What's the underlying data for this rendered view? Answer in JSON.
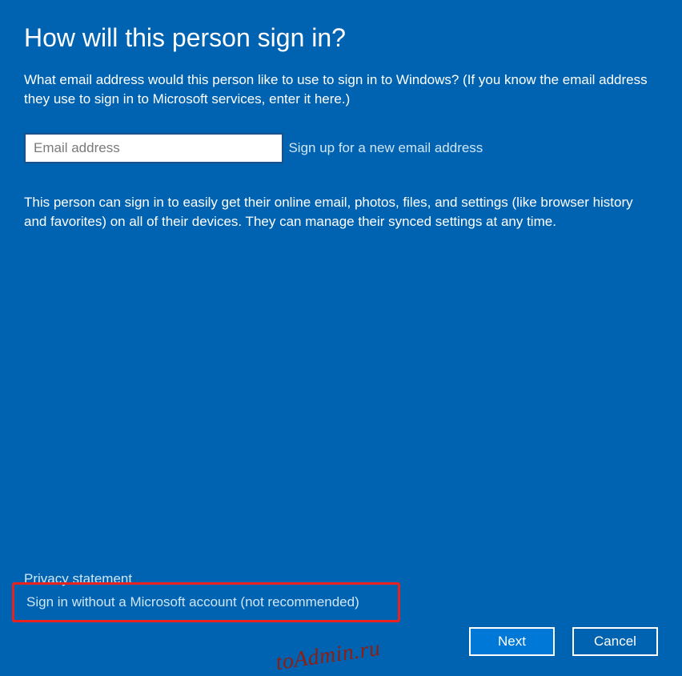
{
  "heading": "How will this person sign in?",
  "subtext": "What email address would this person like to use to sign in to Windows? (If you know the email address they use to sign in to Microsoft services, enter it here.)",
  "email": {
    "value": "",
    "placeholder": "Email address"
  },
  "signup_link": "Sign up for a new email address",
  "info_text": "This person can sign in to easily get their online email, photos, files, and settings (like browser history and favorites) on all of their devices. They can manage their synced settings at any time.",
  "privacy_link": "Privacy statement",
  "sign_in_without_link": "Sign in without a Microsoft account (not recommended)",
  "buttons": {
    "next": "Next",
    "cancel": "Cancel"
  },
  "watermark": "toAdmin.ru",
  "colors": {
    "background": "#0063B1",
    "primary_button": "#0078D7",
    "highlight_border": "#e8221f"
  }
}
